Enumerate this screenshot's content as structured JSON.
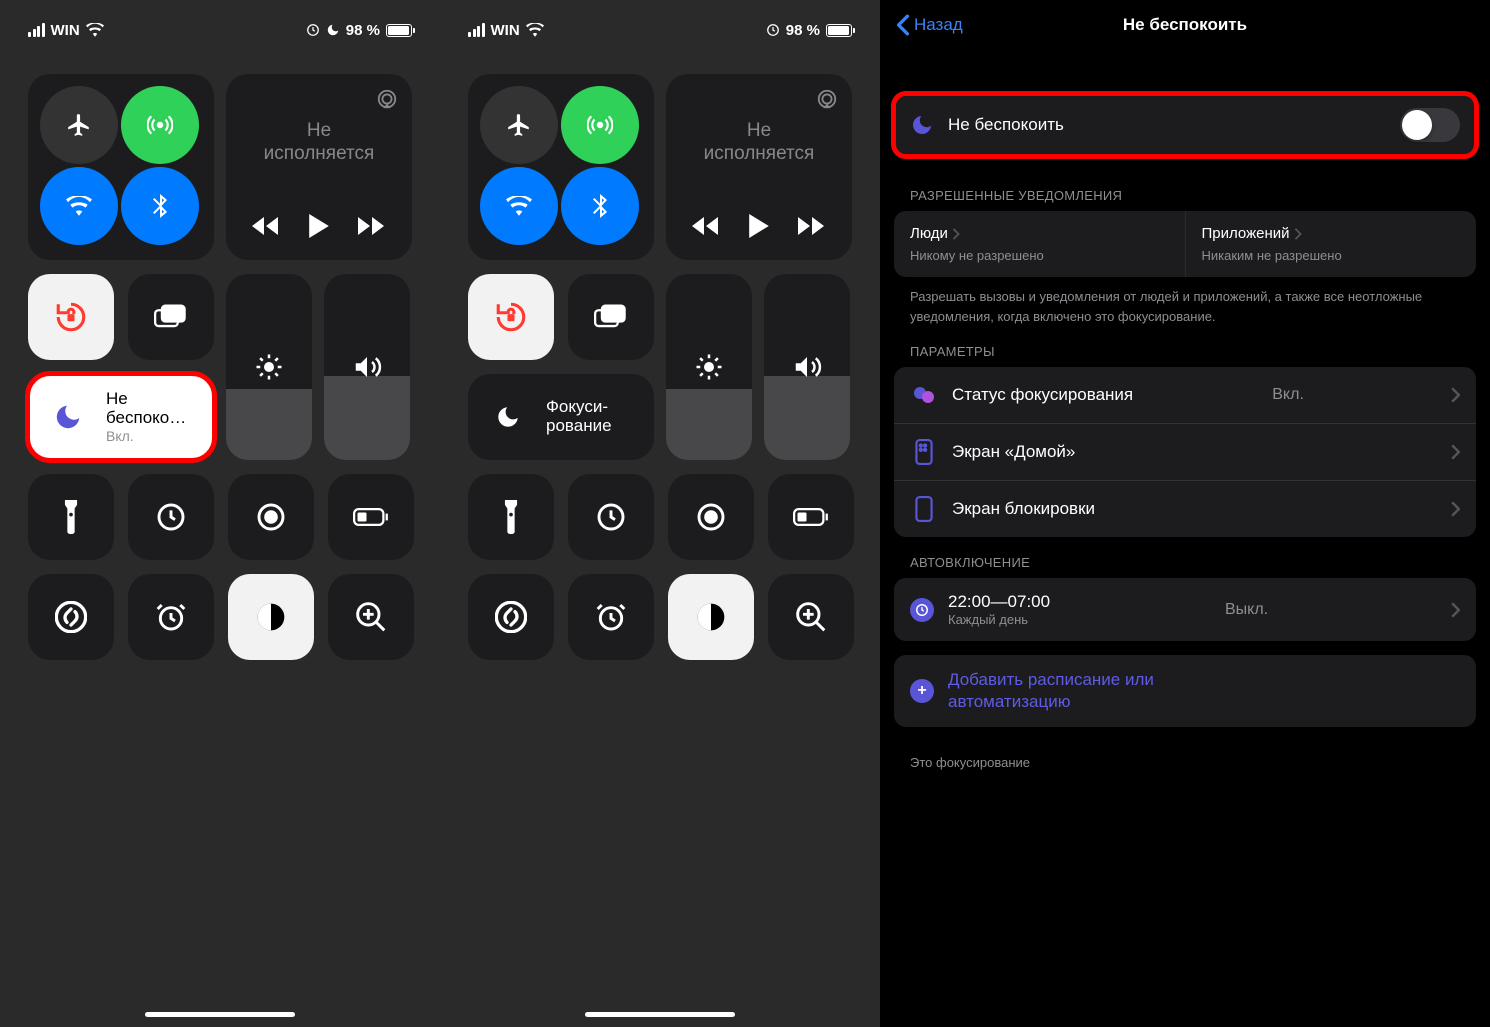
{
  "sb": {
    "carrier": "WIN",
    "battery1": "98 %",
    "battery2": "98 %"
  },
  "music": {
    "line1": "Не",
    "line2": "исполняется"
  },
  "p1": {
    "focus_label": "Не беспоко…",
    "focus_sub": "Вкл."
  },
  "p2": {
    "focus_label1": "Фокуси-",
    "focus_label2": "рование"
  },
  "p3": {
    "back": "Назад",
    "title": "Не беспокоить",
    "dnd_label": "Не беспокоить",
    "sect_allowed": "РАЗРЕШЕННЫЕ УВЕДОМЛЕНИЯ",
    "people": "Люди",
    "people_sub": "Никому не разрешено",
    "apps": "Приложений",
    "apps_sub": "Никаким не разрешено",
    "footnote1": "Разрешать вызовы и уведомления от людей и приложений, а также все неотложные уведомления, когда включено это фокусирование.",
    "sect_params": "ПАРАМЕТРЫ",
    "status": "Статус фокусирования",
    "status_val": "Вкл.",
    "home": "Экран «Домой»",
    "lock": "Экран блокировки",
    "sect_auto": "АВТОВКЛЮЧЕНИЕ",
    "sched_time": "22:00—07:00",
    "sched_sub": "Каждый день",
    "sched_val": "Выкл.",
    "add_sched": "Добавить расписание или автоматизацию",
    "footnote2": "Это фокусирование"
  }
}
